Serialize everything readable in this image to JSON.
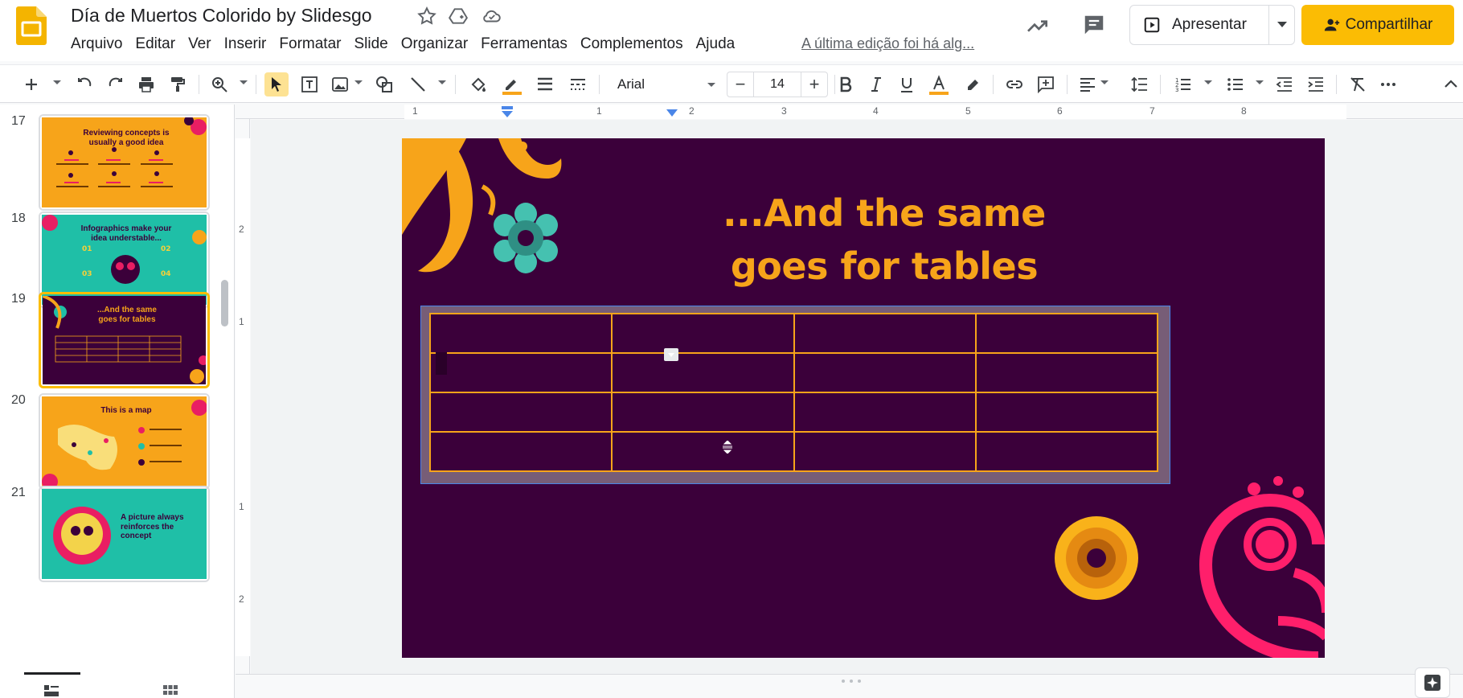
{
  "app": {
    "doc_title": "Día de Muertos Colorido by Slidesgo",
    "last_edit": "A última edição foi há alg...",
    "present_label": "Apresentar",
    "share_label": "Compartilhar",
    "accent_color": "#fbbc04"
  },
  "menu": [
    "Arquivo",
    "Editar",
    "Ver",
    "Inserir",
    "Formatar",
    "Slide",
    "Organizar",
    "Ferramentas",
    "Complementos",
    "Ajuda"
  ],
  "toolbar": {
    "font_name": "Arial",
    "font_size": "14",
    "decrease": "−",
    "increase": "+"
  },
  "filmstrip": {
    "slides": [
      {
        "number": "17",
        "title": "Reviewing concepts is usually a good idea",
        "bg": "#f7a41a"
      },
      {
        "number": "18",
        "title": "Infographics make your idea understable...",
        "bg": "#1fbfa7"
      },
      {
        "number": "19",
        "title": "...And the same goes for tables",
        "bg": "#3b003a"
      },
      {
        "number": "20",
        "title": "This is a map",
        "bg": "#f7a41a"
      },
      {
        "number": "21",
        "title": "A picture always reinforces the concept",
        "bg": "#1fbfa7"
      }
    ]
  },
  "ruler": {
    "h_ticks": [
      "1",
      "1",
      "2",
      "3",
      "4",
      "5",
      "6",
      "7",
      "8"
    ],
    "v_ticks": [
      "2",
      "1",
      "1",
      "2"
    ]
  },
  "slide": {
    "title_line1": "...And the same",
    "title_line2": "goes for tables",
    "bg_color": "#3b003a",
    "title_color": "#f7a41a",
    "table": {
      "rows": 4,
      "cols": 4,
      "border_color": "#f7a41a"
    }
  }
}
